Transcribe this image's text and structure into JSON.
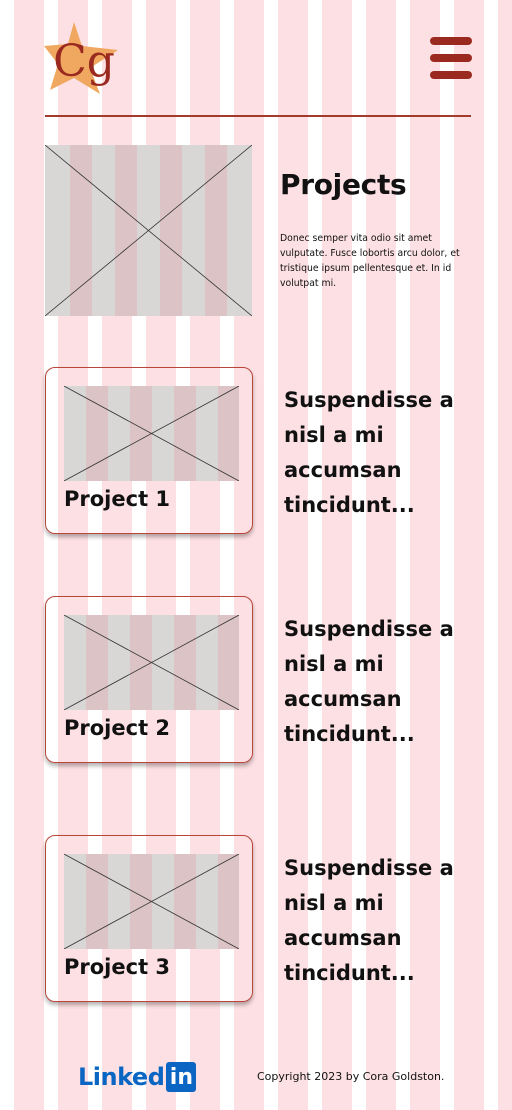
{
  "header": {
    "logo_text": "Cg",
    "menu_icon": "hamburger-menu-icon"
  },
  "intro": {
    "title": "Projects",
    "description": "Donec semper vita odio sit amet vulputate. Fusce lobortis arcu dolor, et tristique ipsum pellentesque et. In id volutpat mi."
  },
  "projects": [
    {
      "label": "Project 1",
      "summary": "Suspendisse a nisl a mi accumsan tincidunt..."
    },
    {
      "label": "Project 2",
      "summary": "Suspendisse a nisl a mi accumsan tincidunt..."
    },
    {
      "label": "Project 3",
      "summary": "Suspendisse a nisl a mi accumsan tincidunt..."
    }
  ],
  "footer": {
    "linkedin_word": "Linked",
    "linkedin_box": "in",
    "copyright": "Copyright 2023 by Cora Goldston."
  },
  "colors": {
    "accent": "#9a2a1f",
    "stripe": "#fde0e3",
    "linkedin": "#0a66c2",
    "logo_star": "#f0a860"
  }
}
